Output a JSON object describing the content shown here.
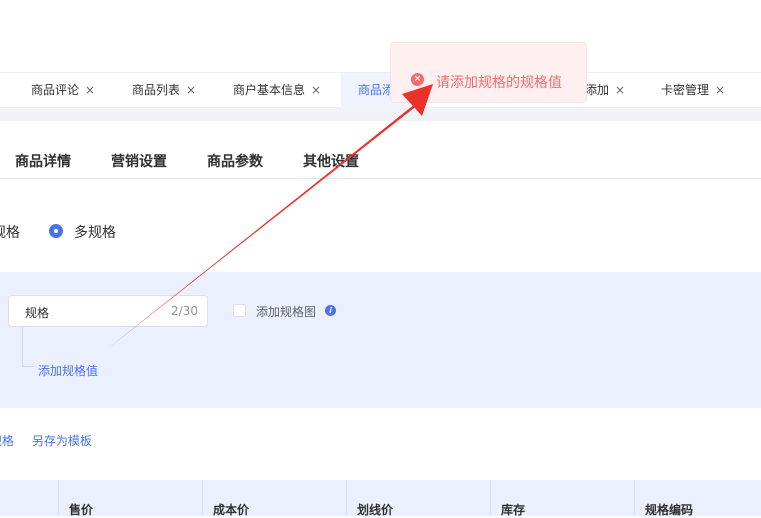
{
  "tabs": [
    {
      "label": "商品评论",
      "close": "×"
    },
    {
      "label": "商品列表",
      "close": "×"
    },
    {
      "label": "商户基本信息",
      "close": "×"
    },
    {
      "label": "商品添",
      "close": ""
    },
    {
      "label": "添加",
      "close": "×"
    },
    {
      "label": "卡密管理",
      "close": "×"
    }
  ],
  "subtabs": [
    "商品详情",
    "营销设置",
    "商品参数",
    "其他设置"
  ],
  "spec_type": {
    "single_label": "规格",
    "multi_label": "多规格"
  },
  "spec_row": {
    "name_value": "规格",
    "name_count": "2/30",
    "add_image_label": "添加规格图",
    "info_icon": "i",
    "add_value_link": "添加规格值"
  },
  "actions": [
    "规格",
    "另存为模板"
  ],
  "table": {
    "headers": [
      "售价",
      "成本价",
      "划线价",
      "库存",
      "规格编码"
    ]
  },
  "toast": {
    "icon": "×",
    "message": "请添加规格的规格值"
  },
  "colors": {
    "primary": "#4a73ea",
    "error": "#f56c6c",
    "annotation_arrow": "#e8322b"
  }
}
